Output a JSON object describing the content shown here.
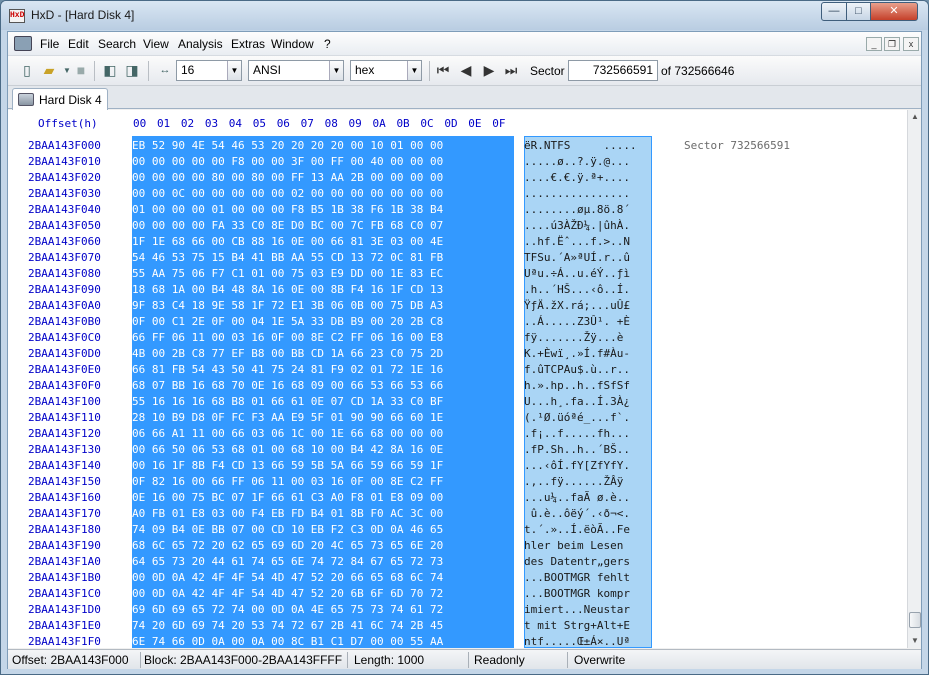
{
  "window": {
    "title": "HxD - [Hard Disk 4]",
    "icon_text": "HxD",
    "minimize_glyph": "—",
    "maximize_glyph": "□",
    "close_glyph": "✕"
  },
  "menubar": {
    "items": [
      "File",
      "Edit",
      "Search",
      "View",
      "Analysis",
      "Extras",
      "Window",
      "?"
    ],
    "mdi_min": "_",
    "mdi_restore": "❐",
    "mdi_close": "x"
  },
  "toolbar": {
    "bytes_per_row": "16",
    "charset": "ANSI",
    "offset_base": "hex",
    "sector_label": "Sector",
    "sector_value": "732566591",
    "sector_total": "of 732566646",
    "icons": {
      "new": "new-file-icon",
      "open": "open-folder-icon",
      "save": "save-icon",
      "disk_open": "open-disk-icon",
      "ram_open": "open-ram-icon",
      "bytes_per_row": "width-arrows-icon",
      "first": "first-sector-icon",
      "prev": "previous-sector-icon",
      "next": "next-sector-icon",
      "last": "last-sector-icon"
    }
  },
  "tabs": [
    {
      "label": "Hard Disk 4"
    }
  ],
  "editor": {
    "offset_header": "Offset(h)",
    "column_headers": [
      "00",
      "01",
      "02",
      "03",
      "04",
      "05",
      "06",
      "07",
      "08",
      "09",
      "0A",
      "0B",
      "0C",
      "0D",
      "0E",
      "0F"
    ],
    "sector_note": "Sector 732566591",
    "rows": [
      {
        "offset": "2BAA143F000",
        "hex": "EB 52 90 4E 54 46 53 20 20 20 20 00 10 01 00 00",
        "text": "ëR.NTFS     ....."
      },
      {
        "offset": "2BAA143F010",
        "hex": "00 00 00 00 00 F8 00 00 3F 00 FF 00 40 00 00 00",
        "text": ".....ø..?.ÿ.@..."
      },
      {
        "offset": "2BAA143F020",
        "hex": "00 00 00 00 80 00 80 00 FF 13 AA 2B 00 00 00 00",
        "text": "....€.€.ÿ.ª+...."
      },
      {
        "offset": "2BAA143F030",
        "hex": "00 00 0C 00 00 00 00 00 02 00 00 00 00 00 00 00",
        "text": "................"
      },
      {
        "offset": "2BAA143F040",
        "hex": "01 00 00 00 01 00 00 00 F8 B5 1B 38 F6 1B 38 B4",
        "text": "........øµ.8ö.8´"
      },
      {
        "offset": "2BAA143F050",
        "hex": "00 00 00 00 FA 33 C0 8E D0 BC 00 7C FB 68 C0 07",
        "text": "....ú3ÀŽÐ¼.|ûhÀ."
      },
      {
        "offset": "2BAA143F060",
        "hex": "1F 1E 68 66 00 CB 88 16 0E 00 66 81 3E 03 00 4E",
        "text": "..hf.Ëˆ...f.>..N"
      },
      {
        "offset": "2BAA143F070",
        "hex": "54 46 53 75 15 B4 41 BB AA 55 CD 13 72 0C 81 FB",
        "text": "TFSu.´A»ªUÍ.r..û"
      },
      {
        "offset": "2BAA143F080",
        "hex": "55 AA 75 06 F7 C1 01 00 75 03 E9 DD 00 1E 83 EC",
        "text": "Uªu.÷Á..u.éÝ..ƒì"
      },
      {
        "offset": "2BAA143F090",
        "hex": "18 68 1A 00 B4 48 8A 16 0E 00 8B F4 16 1F CD 13",
        "text": ".h..´HŠ...‹ô..Í."
      },
      {
        "offset": "2BAA143F0A0",
        "hex": "9F 83 C4 18 9E 58 1F 72 E1 3B 06 0B 00 75 DB A3",
        "text": "ŸƒÄ.žX.rá;...uÛ£"
      },
      {
        "offset": "2BAA143F0B0",
        "hex": "0F 00 C1 2E 0F 00 04 1E 5A 33 DB B9 00 20 2B C8",
        "text": "..Á.....Z3Û¹. +È"
      },
      {
        "offset": "2BAA143F0C0",
        "hex": "66 FF 06 11 00 03 16 0F 00 8E C2 FF 06 16 00 E8",
        "text": "fÿ.......Žÿ...è"
      },
      {
        "offset": "2BAA143F0D0",
        "hex": "4B 00 2B C8 77 EF B8 00 BB CD 1A 66 23 C0 75 2D",
        "text": "K.+Èwï¸.»Í.f#Àu-"
      },
      {
        "offset": "2BAA143F0E0",
        "hex": "66 81 FB 54 43 50 41 75 24 81 F9 02 01 72 1E 16",
        "text": "f.ûTCPAu$.ù..r.."
      },
      {
        "offset": "2BAA143F0F0",
        "hex": "68 07 BB 16 68 70 0E 16 68 09 00 66 53 66 53 66",
        "text": "h.».hp..h..fSfSf"
      },
      {
        "offset": "2BAA143F100",
        "hex": "55 16 16 16 68 B8 01 66 61 0E 07 CD 1A 33 C0 BF",
        "text": "U...h¸.fa..Í.3À¿"
      },
      {
        "offset": "2BAA143F110",
        "hex": "28 10 B9 D8 0F FC F3 AA E9 5F 01 90 90 66 60 1E",
        "text": "(.¹Ø.üóªé_...f`."
      },
      {
        "offset": "2BAA143F120",
        "hex": "06 66 A1 11 00 66 03 06 1C 00 1E 66 68 00 00 00",
        "text": ".f¡..f.....fh..."
      },
      {
        "offset": "2BAA143F130",
        "hex": "00 66 50 06 53 68 01 00 68 10 00 B4 42 8A 16 0E",
        "text": ".fP.Sh..h..´BŠ.."
      },
      {
        "offset": "2BAA143F140",
        "hex": "00 16 1F 8B F4 CD 13 66 59 5B 5A 66 59 66 59 1F",
        "text": "...‹ôÍ.fY[ZfYfY."
      },
      {
        "offset": "2BAA143F150",
        "hex": "0F 82 16 00 66 FF 06 11 00 03 16 0F 00 8E C2 FF",
        "text": ".‚..fÿ......ŽÂÿ"
      },
      {
        "offset": "2BAA143F160",
        "hex": "0E 16 00 75 BC 07 1F 66 61 C3 A0 F8 01 E8 09 00",
        "text": "...u¼..faÃ ø.è.."
      },
      {
        "offset": "2BAA143F170",
        "hex": "A0 FB 01 E8 03 00 F4 EB FD B4 01 8B F0 AC 3C 00",
        "text": " û.è..ôëý´.‹ð¬<."
      },
      {
        "offset": "2BAA143F180",
        "hex": "74 09 B4 0E BB 07 00 CD 10 EB F2 C3 0D 0A 46 65",
        "text": "t.´.»..Í.ëòÃ..Fe"
      },
      {
        "offset": "2BAA143F190",
        "hex": "68 6C 65 72 20 62 65 69 6D 20 4C 65 73 65 6E 20",
        "text": "hler beim Lesen "
      },
      {
        "offset": "2BAA143F1A0",
        "hex": "64 65 73 20 44 61 74 65 6E 74 72 84 67 65 72 73",
        "text": "des Datentr„gers"
      },
      {
        "offset": "2BAA143F1B0",
        "hex": "00 0D 0A 42 4F 4F 54 4D 47 52 20 66 65 68 6C 74",
        "text": "...BOOTMGR fehlt"
      },
      {
        "offset": "2BAA143F1C0",
        "hex": "00 0D 0A 42 4F 4F 54 4D 47 52 20 6B 6F 6D 70 72",
        "text": "...BOOTMGR kompr"
      },
      {
        "offset": "2BAA143F1D0",
        "hex": "69 6D 69 65 72 74 00 0D 0A 4E 65 75 73 74 61 72",
        "text": "imiert...Neustar"
      },
      {
        "offset": "2BAA143F1E0",
        "hex": "74 20 6D 69 74 20 53 74 72 67 2B 41 6C 74 2B 45",
        "text": "t mit Strg+Alt+E"
      },
      {
        "offset": "2BAA143F1F0",
        "hex": "6E 74 66 0D 0A 00 0A 00 8C B1 C1 D7 00 00 55 AA",
        "text": "ntf.....Œ±Á×..Uª"
      }
    ]
  },
  "statusbar": {
    "offset": "Offset: 2BAA143F000",
    "block": "Block: 2BAA143F000-2BAA143FFFF",
    "length": "Length: 1000",
    "mode": "Readonly",
    "insert_mode": "Overwrite"
  },
  "colors": {
    "selection": "#3399ff",
    "text_selection": "#aad5f5",
    "offset_blue": "#0000c8"
  }
}
